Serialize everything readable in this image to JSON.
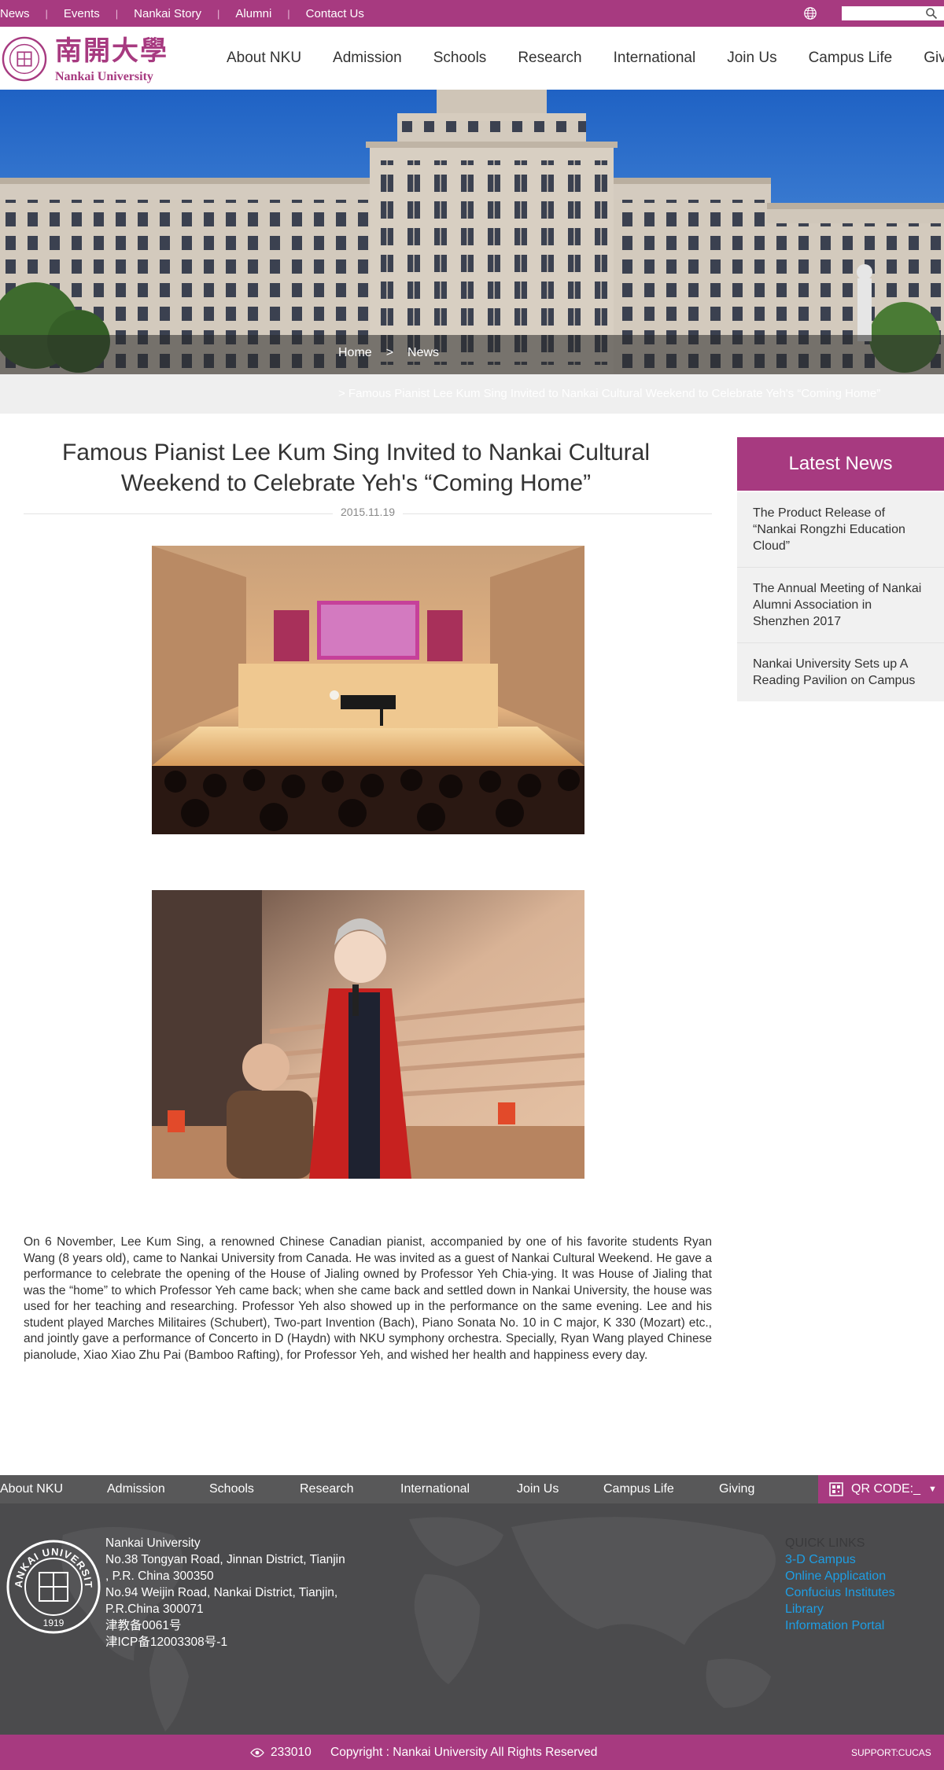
{
  "topbar": {
    "links": [
      "News",
      "Events",
      "Nankai Story",
      "Alumni",
      "Contact Us"
    ],
    "search_placeholder": ""
  },
  "logo": {
    "chinese": "南開大學",
    "english": "Nankai University"
  },
  "mainnav": [
    "About NKU",
    "Admission",
    "Schools",
    "Research",
    "International",
    "Join Us",
    "Campus Life",
    "Giving"
  ],
  "breadcrumb": {
    "home": "Home",
    "separator": ">",
    "current": "News"
  },
  "subcrumb": "> Famous Pianist Lee Kum Sing Invited to Nankai Cultural Weekend to Celebrate Yeh's “Coming Home”",
  "article": {
    "title_line1": "Famous Pianist Lee Kum Sing Invited to Nankai Cultural",
    "title_line2": "Weekend to Celebrate Yeh's “Coming Home”",
    "date": "2015.11.19",
    "body": "On 6 November, Lee Kum Sing, a renowned Chinese Canadian pianist, accompanied by one of his favorite students Ryan Wang (8 years old), came to Nankai University from Canada. He was invited as a guest of Nankai Cultural Weekend. He gave a performance to celebrate the opening of the House of Jialing owned by Professor Yeh Chia-ying. It was House of Jialing that was the “home” to which Professor Yeh came back; when she came back and settled down in Nankai University, the house was used for her teaching and researching. Professor Yeh also showed up in the performance on the same evening. Lee and his student played Marches Militaires (Schubert), Two-part Invention (Bach), Piano Sonata No. 10 in C major, K 330 (Mozart) etc., and jointly gave a performance of Concerto in D (Haydn) with NKU symphony orchestra. Specially, Ryan Wang played Chinese pianolude, Xiao Xiao Zhu Pai (Bamboo Rafting), for Professor Yeh, and wished her health and happiness every day."
  },
  "sidebar": {
    "title": "Latest News",
    "items": [
      "The Product Release of “Nankai Rongzhi Education Cloud”",
      "The Annual Meeting of Nankai Alumni Association in Shenzhen 2017",
      "Nankai University Sets up A Reading Pavilion on Campus"
    ]
  },
  "footer": {
    "nav": [
      "About NKU",
      "Admission",
      "Schools",
      "Research",
      "International",
      "Join Us",
      "Campus Life",
      "Giving"
    ],
    "qr_label": "QR CODE:_",
    "address_lines": [
      "Nankai University",
      "No.38 Tongyan Road, Jinnan District, Tianjin",
      ", P.R. China 300350",
      "No.94 Weijin Road,  Nankai District, Tianjin,",
      "P.R.China  300071",
      "津教备0061号",
      "津ICP备12003308号-1"
    ],
    "seal_text": "NANKAI UNIVERSITY",
    "seal_year": "1919",
    "quick_links_title": "QUICK LINKS",
    "quick_links": [
      "3-D Campus",
      "Online Application",
      "Confucius Institutes",
      "Library",
      "Information Portal"
    ]
  },
  "bottombar": {
    "visits": "233010",
    "copyright": "Copyright : Nankai University All Rights Reserved",
    "support": "SUPPORT:CUCAS"
  },
  "colors": {
    "brand": "#a73a80",
    "footer_bg": "#4b4b4d",
    "link": "#1e9ee4"
  },
  "icons": [
    "globe-icon",
    "search-icon",
    "eye-icon",
    "qr-code-icon",
    "caret-down-icon"
  ]
}
